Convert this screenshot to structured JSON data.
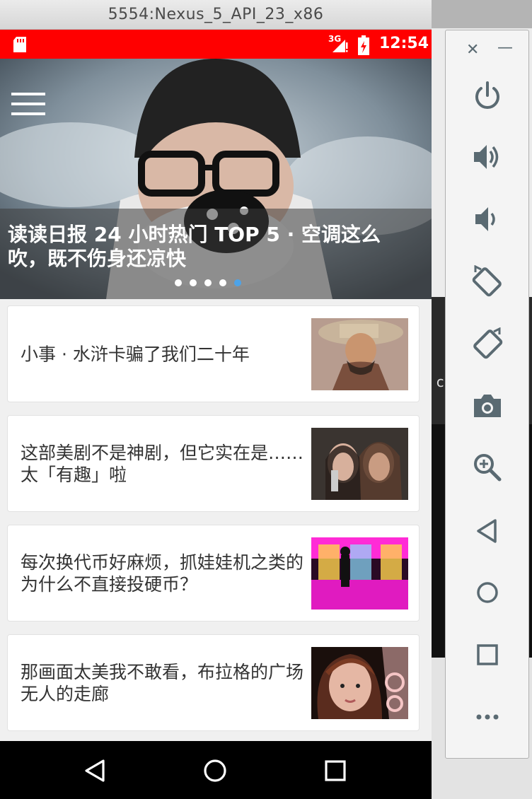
{
  "window": {
    "title": "5554:Nexus_5_API_23_x86"
  },
  "status_bar": {
    "network": "3G",
    "time": "12:54",
    "bar_color": "#ff0000"
  },
  "hero": {
    "title": "读读日报 24 小时热门 TOP 5 · 空调这么吹，既不伤身还凉快",
    "dots_total": 5,
    "dot_active_index": 4,
    "accent_color": "#4da3e8"
  },
  "news": [
    {
      "title": "小事 · 水浒卡骗了我们二十年",
      "thumb": "cowboy-hat-man-photo"
    },
    {
      "title": "这部美剧不是神剧，但它实在是……太「有趣」啦",
      "thumb": "two-women-selfie-photo"
    },
    {
      "title": "每次换代币好麻烦，抓娃娃机之类的为什么不直接投硬币？",
      "thumb": "claw-machine-photo"
    },
    {
      "title": "那画面太美我不敢看，布拉格的广场无人的走廊",
      "thumb": "girl-portrait-photo"
    }
  ],
  "nav_bar": {
    "back": "back-triangle-icon",
    "home": "home-circle-icon",
    "recents": "recents-square-icon"
  },
  "side_panel": {
    "tools": [
      "power-icon",
      "volume-up-icon",
      "volume-down-icon",
      "rotate-left-icon",
      "rotate-right-icon",
      "camera-icon",
      "zoom-icon",
      "back-icon",
      "home-icon",
      "overview-icon",
      "more-icon"
    ],
    "icon_color": "#5a6a72"
  },
  "background": {
    "code_fragment": "ci"
  }
}
